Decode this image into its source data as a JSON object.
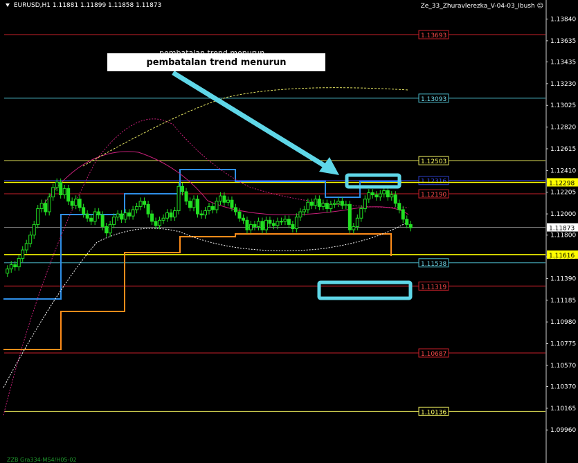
{
  "window": {
    "symbol_timeframe": "EURUSD,H1",
    "ohlc": "1.11881 1.11899 1.11858 1.11873",
    "indicator_name": "Ze_33_Zhuravlerezka_V-04-03_Ibush",
    "smiley_icon": "smiley-icon",
    "footer_note": "ZZB Gra334-MS4/H05-02"
  },
  "annotation": {
    "label": "pembatalan trend menurun",
    "ghost_text": "pembatalan trend menurun",
    "arrow_color": "#5fd7e8",
    "box_color": "#5fd7e8"
  },
  "colors": {
    "background": "#000000",
    "candle": "#22e022",
    "price_axis_line": "#ffffff",
    "red_level": "#c8202a",
    "cyan_level": "#4ab8c8",
    "yellow_level": "#ffff00",
    "blue_step": "#2f8fe8",
    "orange_step": "#ff8c1a"
  },
  "chart_data": {
    "type": "candlestick",
    "ylim": [
      1.09844,
      1.13935
    ],
    "price_ticks": [
      "1.13840",
      "1.13635",
      "1.13435",
      "1.13230",
      "1.13025",
      "1.12820",
      "1.12615",
      "1.12410",
      "1.12205",
      "1.12000",
      "1.11800",
      "1.11595",
      "1.11390",
      "1.11185",
      "1.10980",
      "1.10775",
      "1.10570",
      "1.10370",
      "1.10165",
      "1.09960"
    ],
    "levels": [
      {
        "value": "1.13693",
        "color": "#c8202a",
        "label_bg": "#000000",
        "label_fg": "#ff4a4a",
        "style": "solid"
      },
      {
        "value": "1.13093",
        "color": "#4ab8c8",
        "label_bg": "#000000",
        "label_fg": "#6fd7e8",
        "style": "solid"
      },
      {
        "value": "1.12503",
        "color": "#e8e85a",
        "label_bg": "#000000",
        "label_fg": "#ffff66",
        "style": "solid"
      },
      {
        "value": "1.12316",
        "color": "#3040d0",
        "label_bg": "#000000",
        "label_fg": "#3a52ff",
        "style": "solid"
      },
      {
        "value": "1.12190",
        "color": "#c8202a",
        "label_bg": "#000000",
        "label_fg": "#ff4a4a",
        "style": "solid"
      },
      {
        "value": "1.11538",
        "color": "#4ab8c8",
        "label_bg": "#000000",
        "label_fg": "#6fd7e8",
        "style": "solid"
      },
      {
        "value": "1.11319",
        "color": "#c8202a",
        "label_bg": "#000000",
        "label_fg": "#ff4a4a",
        "style": "solid"
      },
      {
        "value": "1.10687",
        "color": "#c8202a",
        "label_bg": "#000000",
        "label_fg": "#ff4a4a",
        "style": "solid"
      },
      {
        "value": "1.10136",
        "color": "#e8e85a",
        "label_bg": "#000000",
        "label_fg": "#ffff66",
        "style": "solid"
      }
    ],
    "axis_badges": [
      {
        "value": "1.12298",
        "bg": "#ffff00",
        "fg": "#000000"
      },
      {
        "value": "1.11873",
        "bg": "#ffffff",
        "fg": "#000000"
      },
      {
        "value": "1.11616",
        "bg": "#ffff00",
        "fg": "#000000"
      }
    ],
    "close_prices": [
      1.1148,
      1.1152,
      1.115,
      1.1158,
      1.1166,
      1.1172,
      1.118,
      1.119,
      1.1205,
      1.121,
      1.1202,
      1.1216,
      1.1225,
      1.123,
      1.1218,
      1.1224,
      1.1212,
      1.1208,
      1.1214,
      1.1206,
      1.12,
      1.1196,
      1.1193,
      1.1202,
      1.1199,
      1.1188,
      1.1182,
      1.119,
      1.1197,
      1.12,
      1.1195,
      1.1201,
      1.1198,
      1.1204,
      1.1207,
      1.1212,
      1.1209,
      1.12,
      1.1193,
      1.1189,
      1.1194,
      1.1196,
      1.1201,
      1.1197,
      1.1203,
      1.1226,
      1.1221,
      1.1212,
      1.1206,
      1.1214,
      1.12,
      1.1199,
      1.1203,
      1.1207,
      1.1204,
      1.1212,
      1.1217,
      1.1211,
      1.1213,
      1.1206,
      1.1202,
      1.1196,
      1.1194,
      1.1185,
      1.119,
      1.1188,
      1.1193,
      1.1185,
      1.1194,
      1.1191,
      1.1189,
      1.1193,
      1.1193,
      1.1195,
      1.119,
      1.1186,
      1.1197,
      1.1202,
      1.1204,
      1.1211,
      1.1208,
      1.1214,
      1.1207,
      1.121,
      1.1205,
      1.1209,
      1.121,
      1.1212,
      1.1208,
      1.1209,
      1.1185,
      1.1188,
      1.1196,
      1.1205,
      1.1214,
      1.122,
      1.1218,
      1.1216,
      1.1219,
      1.1222,
      1.1216,
      1.1218,
      1.121,
      1.1204,
      1.1195,
      1.119,
      1.1187
    ]
  }
}
